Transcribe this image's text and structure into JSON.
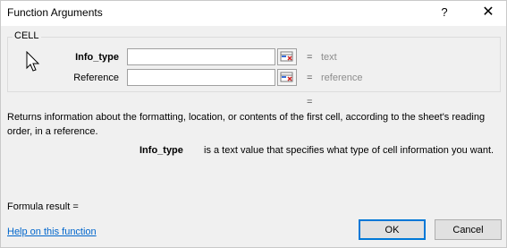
{
  "dialog": {
    "title": "Function Arguments",
    "help_glyph": "?",
    "close_glyph": "✕"
  },
  "group": {
    "label": "CELL"
  },
  "arguments": [
    {
      "label": "Info_type",
      "value": "",
      "equals": "=",
      "hint": "text"
    },
    {
      "label": "Reference",
      "value": "",
      "equals": "=",
      "hint": "reference"
    }
  ],
  "result_equals": "=",
  "description": "Returns information about the formatting, location, or contents of the first cell, according to the sheet's reading order, in a reference.",
  "arg_description": {
    "name": "Info_type",
    "text": "is a text value that specifies what type of cell information you want."
  },
  "formula_result": "Formula result =",
  "help_link": "Help on this function",
  "buttons": {
    "ok": "OK",
    "cancel": "Cancel"
  },
  "icons": {
    "cursor": "arrow-cursor-icon",
    "collapse": "collapse-dialog-icon"
  },
  "colors": {
    "link": "#0066cc",
    "hint": "#8c8c8c",
    "ok_border": "#0078d7"
  }
}
